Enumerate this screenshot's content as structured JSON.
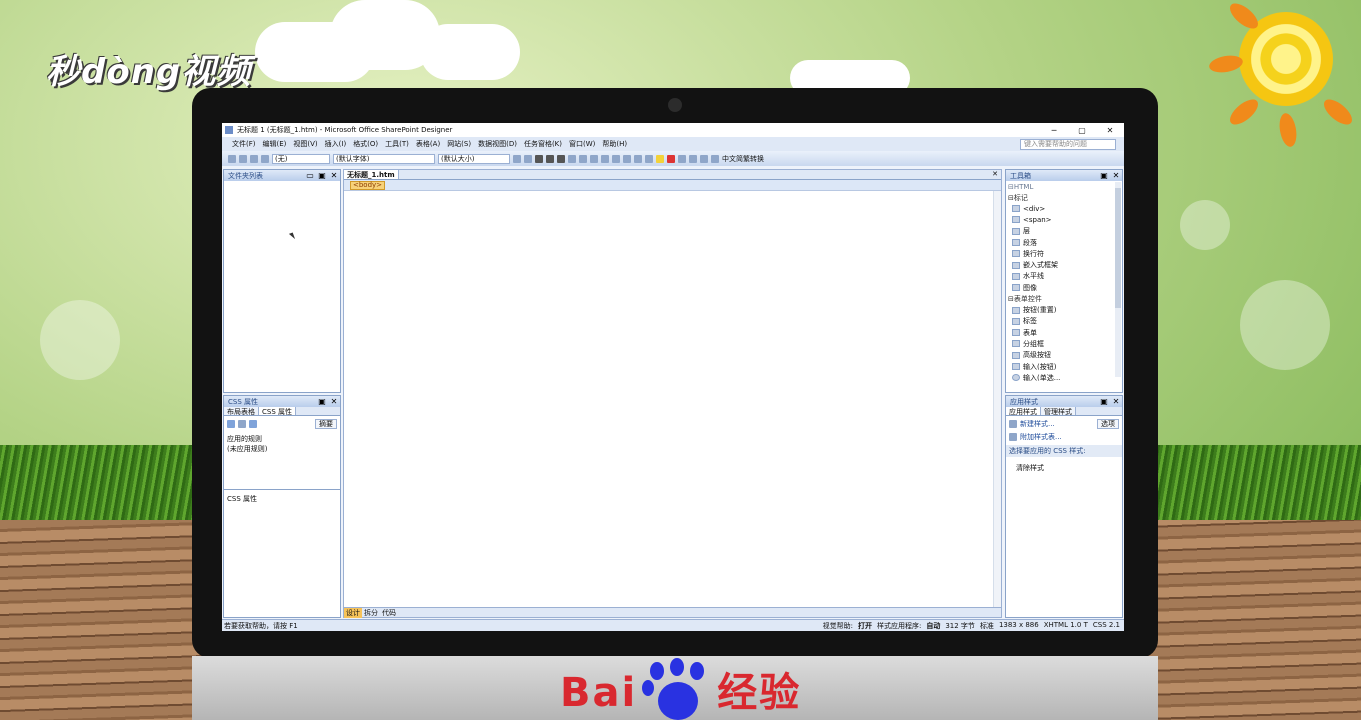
{
  "watermark_top_left": "秒dòng视频",
  "watermark_bottom": {
    "brand": "Bai",
    "suffix": "经验"
  },
  "window": {
    "title": "无标题 1 (无标题_1.htm) - Microsoft Office SharePoint Designer",
    "controls": [
      "─",
      "▢",
      "✕"
    ]
  },
  "menu": [
    "文件(F)",
    "编辑(E)",
    "视图(V)",
    "插入(I)",
    "格式(O)",
    "工具(T)",
    "表格(A)",
    "网站(S)",
    "数据视图(D)",
    "任务窗格(K)",
    "窗口(W)",
    "帮助(H)"
  ],
  "help_placeholder": "键入需要帮助的问题",
  "toolbar": {
    "style_select": "(无)",
    "font_select": "(默认字体)",
    "size_select": "(默认大小)",
    "convert": "中文简繁转换"
  },
  "folder_pane": {
    "title": "文件夹列表"
  },
  "css_pane": {
    "title": "CSS 属性",
    "tabs": [
      "布局表格",
      "CSS 属性"
    ],
    "summary_btn": "摘要",
    "applied_label": "应用的规则",
    "applied_value": "(未应用规则)",
    "props_label": "CSS 属性"
  },
  "editor": {
    "doc_tab": "无标题_1.htm",
    "tag": "<body>",
    "views": [
      "设计",
      "拆分",
      "代码"
    ]
  },
  "toolbox": {
    "title": "工具箱",
    "root": "HTML",
    "groups": [
      {
        "label": "标记",
        "items": [
          "<div>",
          "<span>",
          "层",
          "段落",
          "换行符",
          "嵌入式框架",
          "水平线",
          "图像"
        ]
      },
      {
        "label": "表单控件",
        "items": [
          "按钮(重置)",
          "标签",
          "表单",
          "分组框",
          "高级按钮",
          "输入(按钮)",
          "输入(单选..."
        ]
      }
    ]
  },
  "apply_styles": {
    "title": "应用样式",
    "tabs": [
      "应用样式",
      "管理样式"
    ],
    "new_style": "新建样式...",
    "attach": "附加样式表...",
    "options": "选项",
    "select_label": "选择要应用的 CSS 样式:",
    "clear": "清除样式"
  },
  "status": {
    "left": "若要获取帮助，请按 F1",
    "visual_aid": "视觉帮助:",
    "visual_aid_val": "打开",
    "style_app": "样式应用程序:",
    "style_app_val": "自动",
    "size": "312 字节",
    "mode": "标准",
    "dims": "1383 x 886",
    "doctype": "XHTML 1.0 T",
    "css": "CSS 2.1"
  }
}
